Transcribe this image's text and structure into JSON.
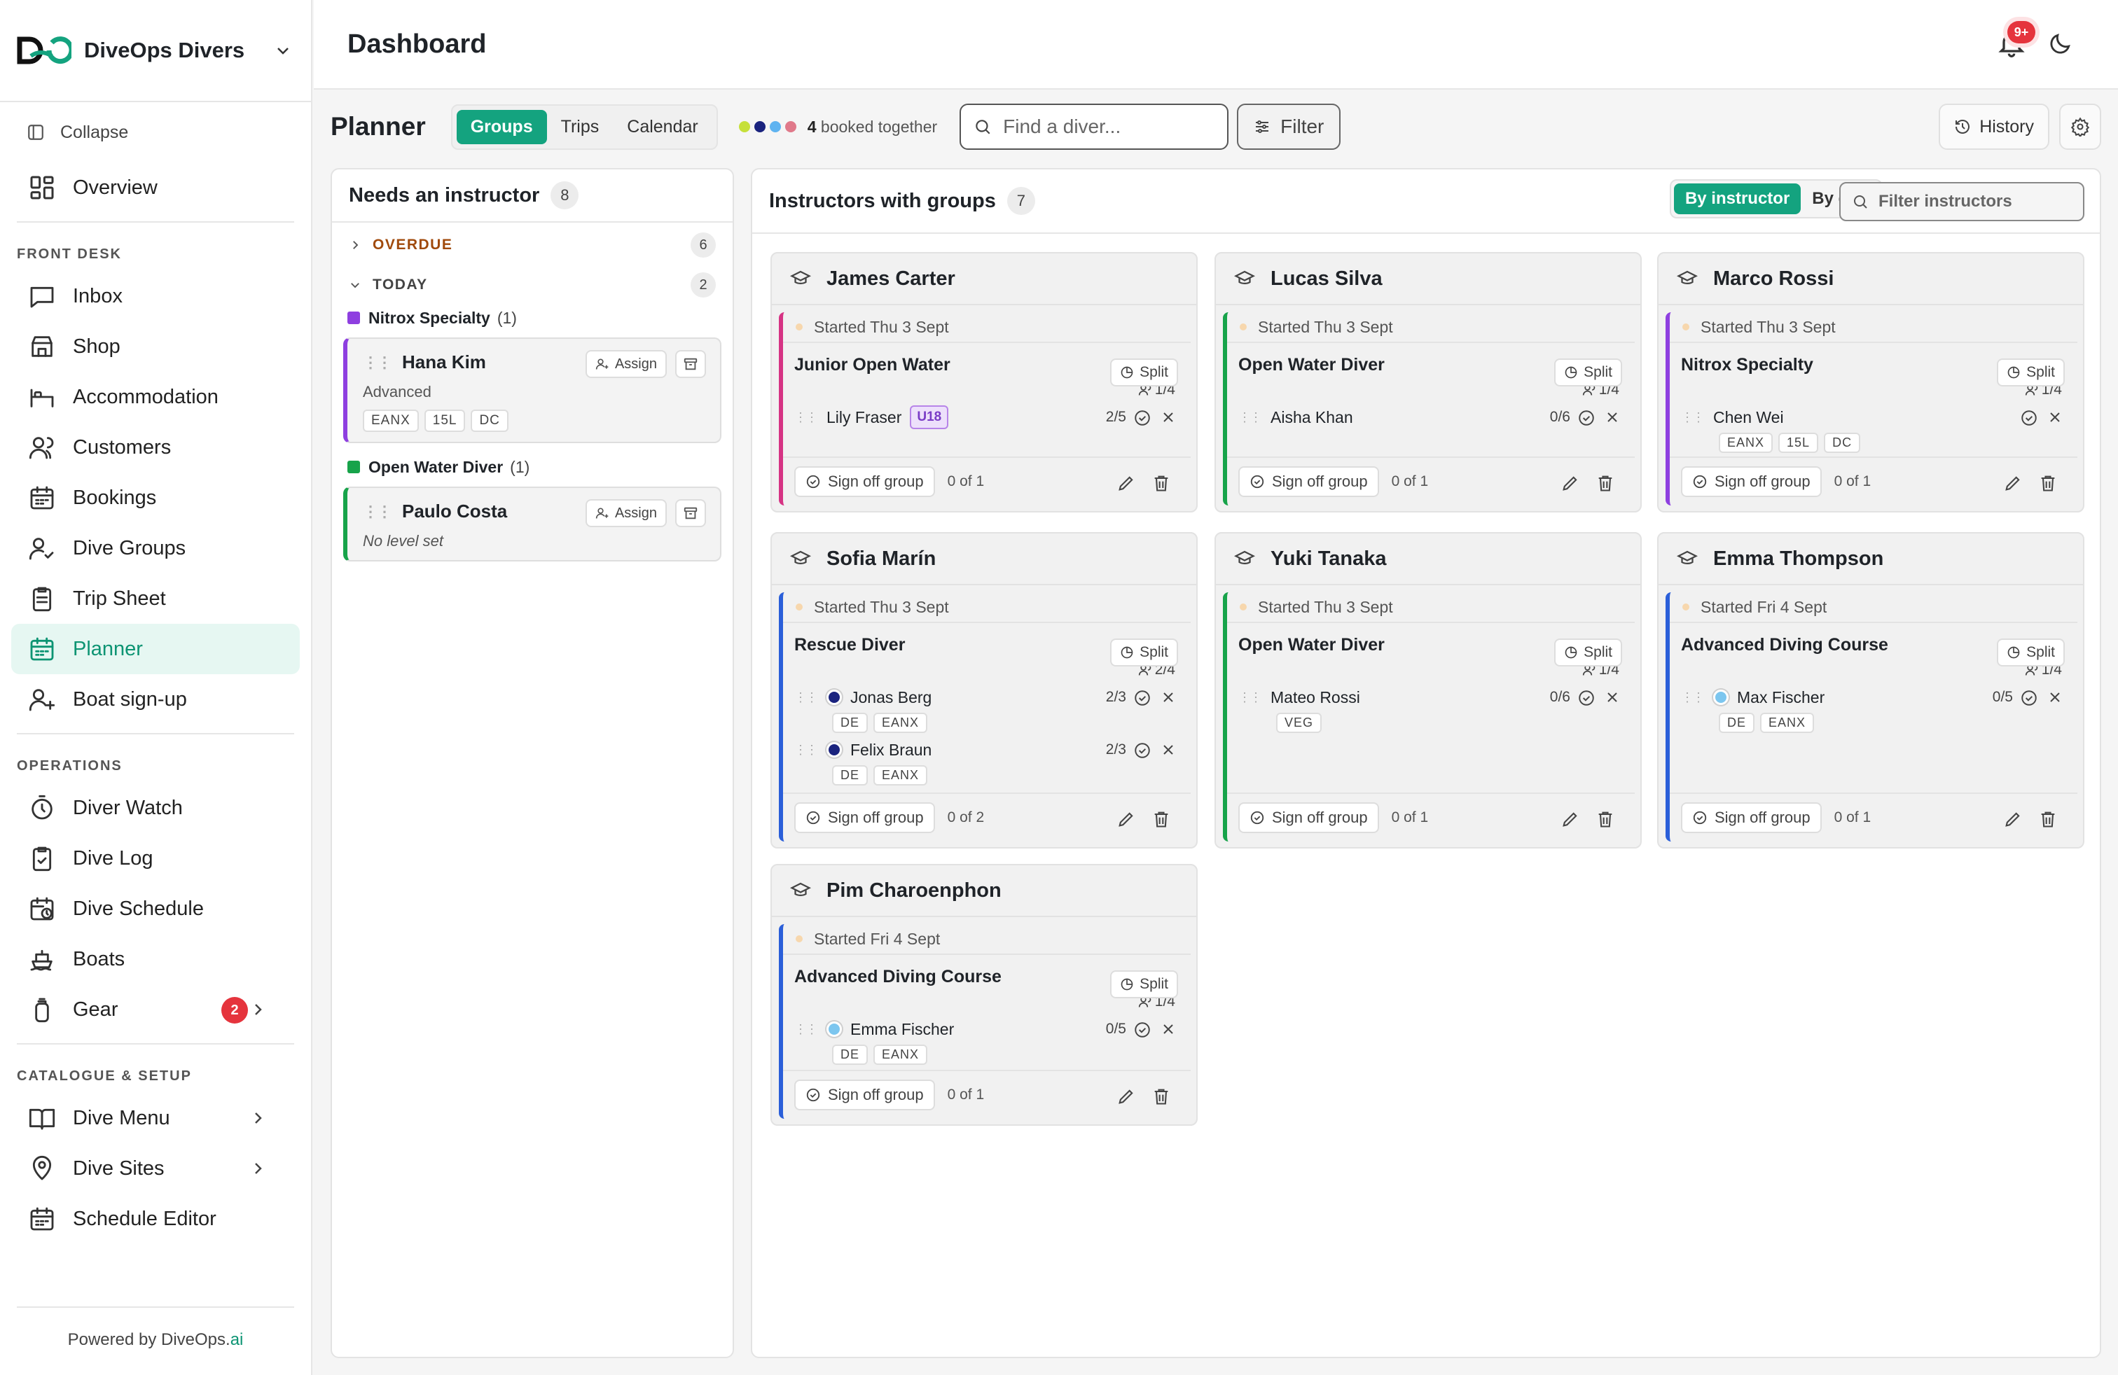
{
  "brand": {
    "name": "DiveOps Divers"
  },
  "sidebar": {
    "collapse": "Collapse",
    "overview": "Overview",
    "front_desk_label": "FRONT DESK",
    "front_desk": [
      {
        "label": "Inbox",
        "icon": "inbox-icon"
      },
      {
        "label": "Shop",
        "icon": "shop-icon"
      },
      {
        "label": "Accommodation",
        "icon": "bed-icon"
      },
      {
        "label": "Customers",
        "icon": "users-icon"
      },
      {
        "label": "Bookings",
        "icon": "calendar-icon"
      },
      {
        "label": "Dive Groups",
        "icon": "user-check-icon"
      },
      {
        "label": "Trip Sheet",
        "icon": "clipboard-icon"
      },
      {
        "label": "Planner",
        "icon": "calendar-grid-icon",
        "active": true
      },
      {
        "label": "Boat sign-up",
        "icon": "user-plus-icon"
      }
    ],
    "operations_label": "OPERATIONS",
    "operations": [
      {
        "label": "Diver Watch",
        "icon": "stopwatch-icon"
      },
      {
        "label": "Dive Log",
        "icon": "clipboard-check-icon"
      },
      {
        "label": "Dive Schedule",
        "icon": "calendar-clock-icon"
      },
      {
        "label": "Boats",
        "icon": "ship-icon"
      },
      {
        "label": "Gear",
        "icon": "tank-icon",
        "badge": "2"
      }
    ],
    "catalogue_label": "CATALOGUE & SETUP",
    "catalogue": [
      {
        "label": "Dive Menu",
        "icon": "book-icon"
      },
      {
        "label": "Dive Sites",
        "icon": "map-pin-icon"
      },
      {
        "label": "Schedule Editor",
        "icon": "calendar-icon"
      }
    ],
    "powered_prefix": "Powered by DiveOps.",
    "powered_suffix": "ai"
  },
  "header": {
    "title": "Dashboard",
    "notif_badge": "9+"
  },
  "toolbar": {
    "title": "Planner",
    "tabs": [
      "Groups",
      "Trips",
      "Calendar"
    ],
    "booked_count": "4",
    "booked_text": "booked together",
    "search_placeholder": "Find a diver...",
    "filter": "Filter",
    "history": "History",
    "dot_colors": [
      "#c6e03a",
      "#1a237e",
      "#5fb3f0",
      "#e0798a"
    ]
  },
  "needs": {
    "title": "Needs an instructor",
    "count": "8",
    "overdue_label": "OVERDUE",
    "overdue_count": "6",
    "today_label": "TODAY",
    "today_count": "2",
    "courses": [
      {
        "name": "Nitrox Specialty",
        "count": "(1)",
        "color": "#8e3fe0",
        "diver": {
          "name": "Hana Kim",
          "level": "Advanced",
          "tags": [
            "EANX",
            "15L",
            "DC"
          ]
        }
      },
      {
        "name": "Open Water Diver",
        "count": "(1)",
        "color": "#17a34a",
        "diver": {
          "name": "Paulo Costa",
          "level": "No level set",
          "tags": []
        }
      }
    ],
    "assign": "Assign"
  },
  "instructors": {
    "title": "Instructors with groups",
    "count": "7",
    "view_by_instructor": "By instructor",
    "view_by_day": "By day",
    "filter_placeholder": "Filter instructors",
    "split": "Split",
    "sign_off": "Sign off group",
    "cards": [
      {
        "name": "James Carter",
        "started": "Started Thu 3 Sept",
        "course": "Junior Open Water",
        "cap": "1/4",
        "color": "#d63384",
        "of": "0 of 1",
        "divers": [
          {
            "name": "Lily Fraser",
            "badge": "U18",
            "prog": "2/5",
            "tags": []
          }
        ]
      },
      {
        "name": "Lucas Silva",
        "started": "Started Thu 3 Sept",
        "course": "Open Water Diver",
        "cap": "1/4",
        "color": "#17a34a",
        "of": "0 of 1",
        "divers": [
          {
            "name": "Aisha Khan",
            "prog": "0/6",
            "tags": []
          }
        ]
      },
      {
        "name": "Marco Rossi",
        "started": "Started Thu 3 Sept",
        "course": "Nitrox Specialty",
        "cap": "1/4",
        "color": "#8e3fe0",
        "of": "0 of 1",
        "divers": [
          {
            "name": "Chen Wei",
            "prog": "",
            "tags": [
              "EANX",
              "15L",
              "DC"
            ]
          }
        ]
      },
      {
        "name": "Sofia Marín",
        "started": "Started Thu 3 Sept",
        "course": "Rescue Diver",
        "cap": "2/4",
        "color": "#2b5fd9",
        "of": "0 of 2",
        "divers": [
          {
            "name": "Jonas Berg",
            "dot": "#1a237e",
            "prog": "2/3",
            "tags": [
              "DE",
              "EANX"
            ]
          },
          {
            "name": "Felix Braun",
            "dot": "#1a237e",
            "prog": "2/3",
            "tags": [
              "DE",
              "EANX"
            ]
          }
        ]
      },
      {
        "name": "Yuki Tanaka",
        "started": "Started Thu 3 Sept",
        "course": "Open Water Diver",
        "cap": "1/4",
        "color": "#17a34a",
        "of": "0 of 1",
        "divers": [
          {
            "name": "Mateo Rossi",
            "prog": "0/6",
            "tags": [
              "VEG"
            ]
          }
        ]
      },
      {
        "name": "Emma Thompson",
        "started": "Started Fri 4 Sept",
        "course": "Advanced Diving Course",
        "cap": "1/4",
        "color": "#2b5fd9",
        "of": "0 of 1",
        "divers": [
          {
            "name": "Max Fischer",
            "dot": "#7cc6ef",
            "prog": "0/5",
            "tags": [
              "DE",
              "EANX"
            ]
          }
        ]
      },
      {
        "name": "Pim Charoenphon",
        "started": "Started Fri 4 Sept",
        "course": "Advanced Diving Course",
        "cap": "1/4",
        "color": "#2b5fd9",
        "of": "0 of 1",
        "divers": [
          {
            "name": "Emma Fischer",
            "dot": "#7cc6ef",
            "prog": "0/5",
            "tags": [
              "DE",
              "EANX"
            ]
          }
        ]
      }
    ]
  }
}
